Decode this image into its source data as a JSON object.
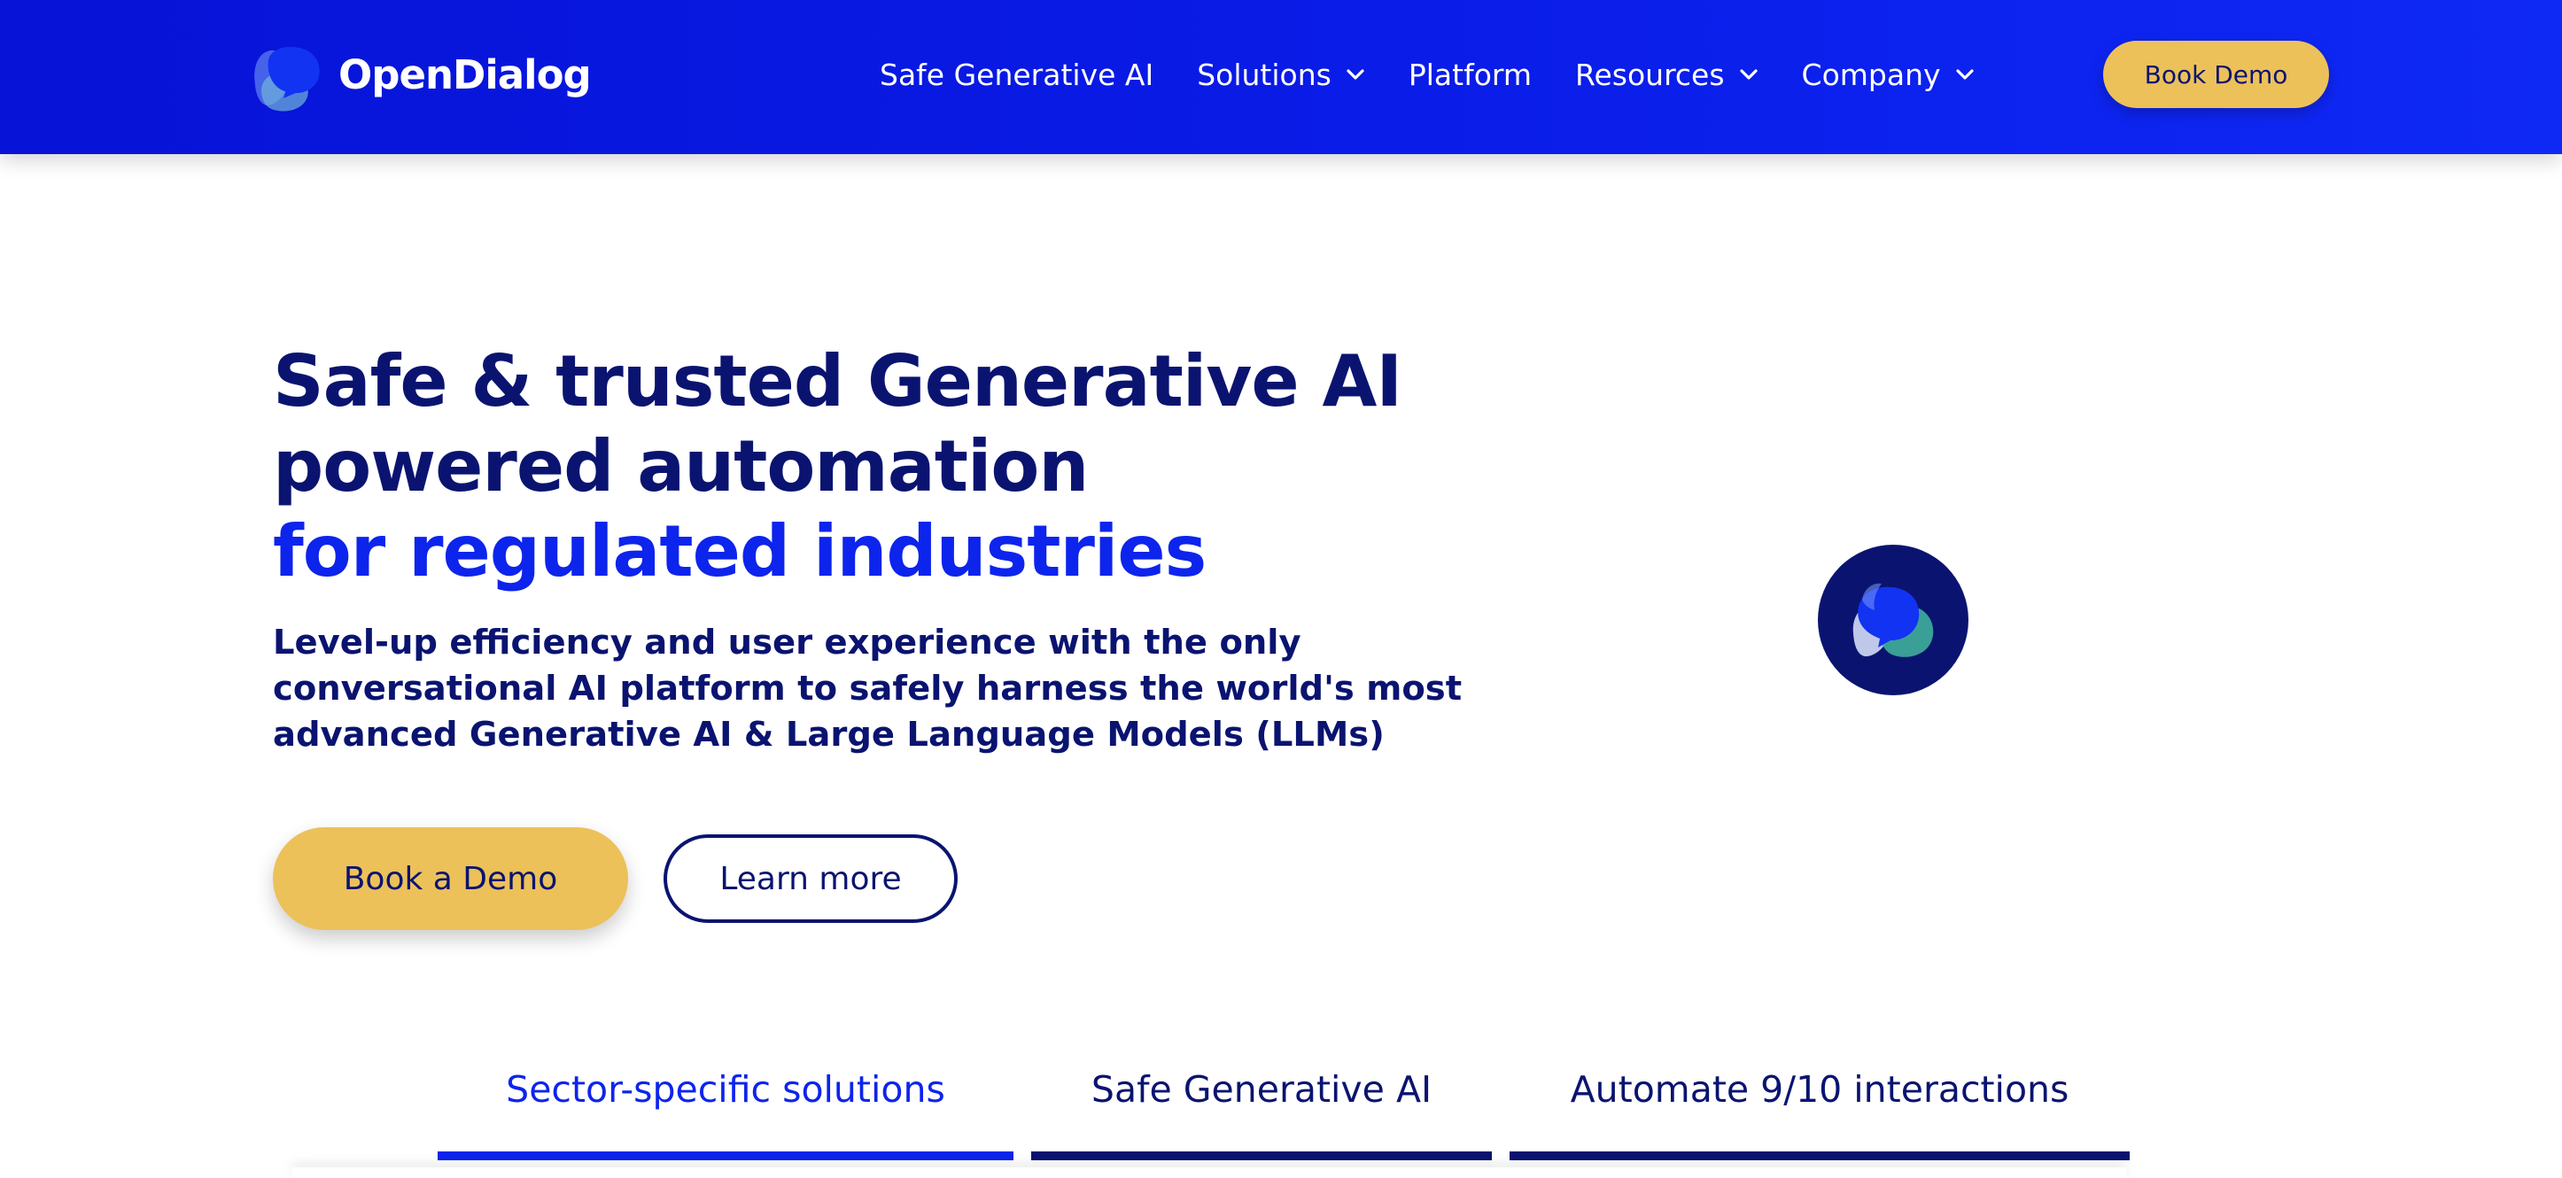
{
  "brand": {
    "name": "OpenDialog",
    "colors": {
      "nav_bg": "#0a1ce8",
      "primary_text": "#0a1470",
      "accent_blue": "#0d24ec",
      "cta_yellow": "#ecc15a"
    }
  },
  "nav": {
    "items": [
      {
        "label": "Safe Generative AI",
        "has_dropdown": false
      },
      {
        "label": "Solutions",
        "has_dropdown": true,
        "icon": "chevron-down-icon"
      },
      {
        "label": "Platform",
        "has_dropdown": false
      },
      {
        "label": "Resources",
        "has_dropdown": true,
        "icon": "chevron-down-icon"
      },
      {
        "label": "Company",
        "has_dropdown": true,
        "icon": "chevron-down-icon"
      }
    ],
    "cta_label": "Book Demo"
  },
  "hero": {
    "title_lines": [
      "Safe & trusted Generative AI",
      "powered automation"
    ],
    "title_accent": "for regulated industries",
    "subtitle_lines": [
      "Level-up efficiency and user experience with the only",
      "conversational AI platform to safely harness the world's most",
      "advanced Generative AI & Large Language Models (LLMs)"
    ],
    "primary_button": "Book a Demo",
    "secondary_button": "Learn more",
    "badge_icon": "opendialog-chat-bubble-icon"
  },
  "tabs": [
    {
      "label": "Sector-specific solutions",
      "active": true
    },
    {
      "label": "Safe Generative AI",
      "active": false
    },
    {
      "label": "Automate 9/10 interactions",
      "active": false
    }
  ]
}
